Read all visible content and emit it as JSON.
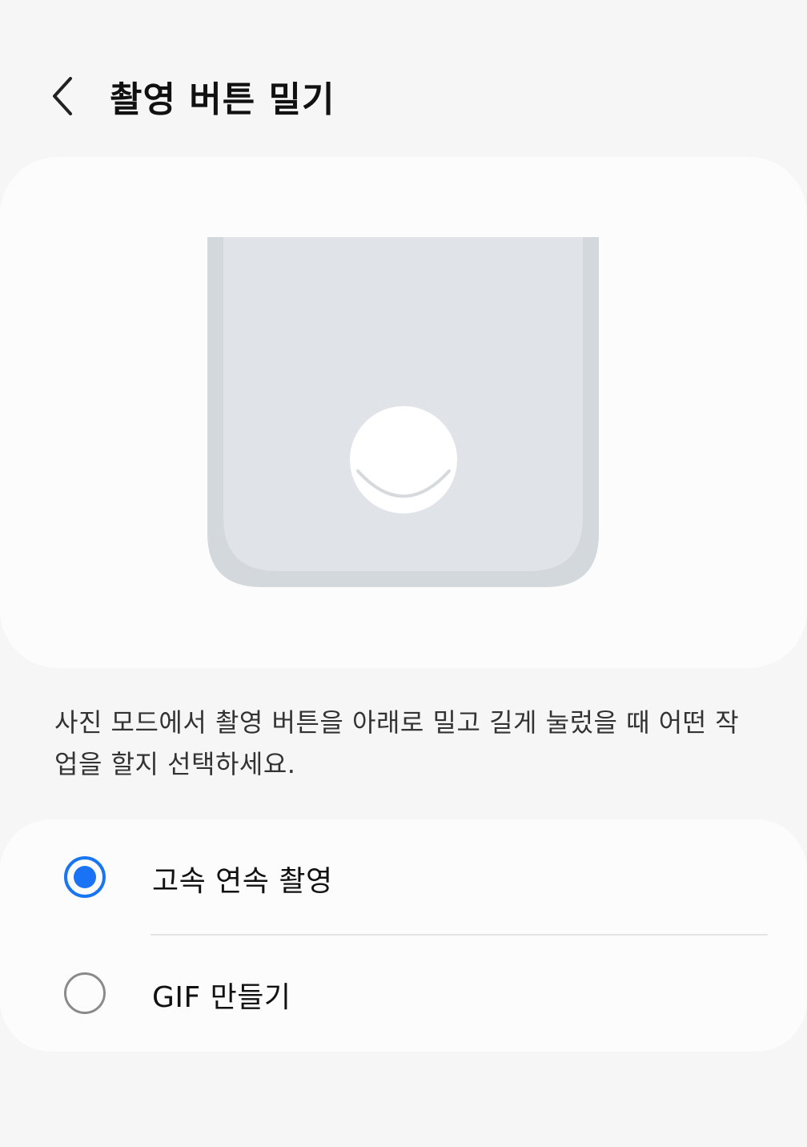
{
  "header": {
    "back_icon": "chevron-left-icon",
    "title": "촬영 버튼 밀기"
  },
  "description": "사진 모드에서 촬영 버튼을 아래로 밀고 길게 눌렀을 때 어떤 작업을 할지 선택하세요.",
  "options": [
    {
      "label": "고속 연속 촬영",
      "selected": true
    },
    {
      "label": "GIF 만들기",
      "selected": false
    }
  ],
  "colors": {
    "accent": "#1a73f5",
    "background": "#f6f6f6",
    "card": "#fcfcfc"
  }
}
